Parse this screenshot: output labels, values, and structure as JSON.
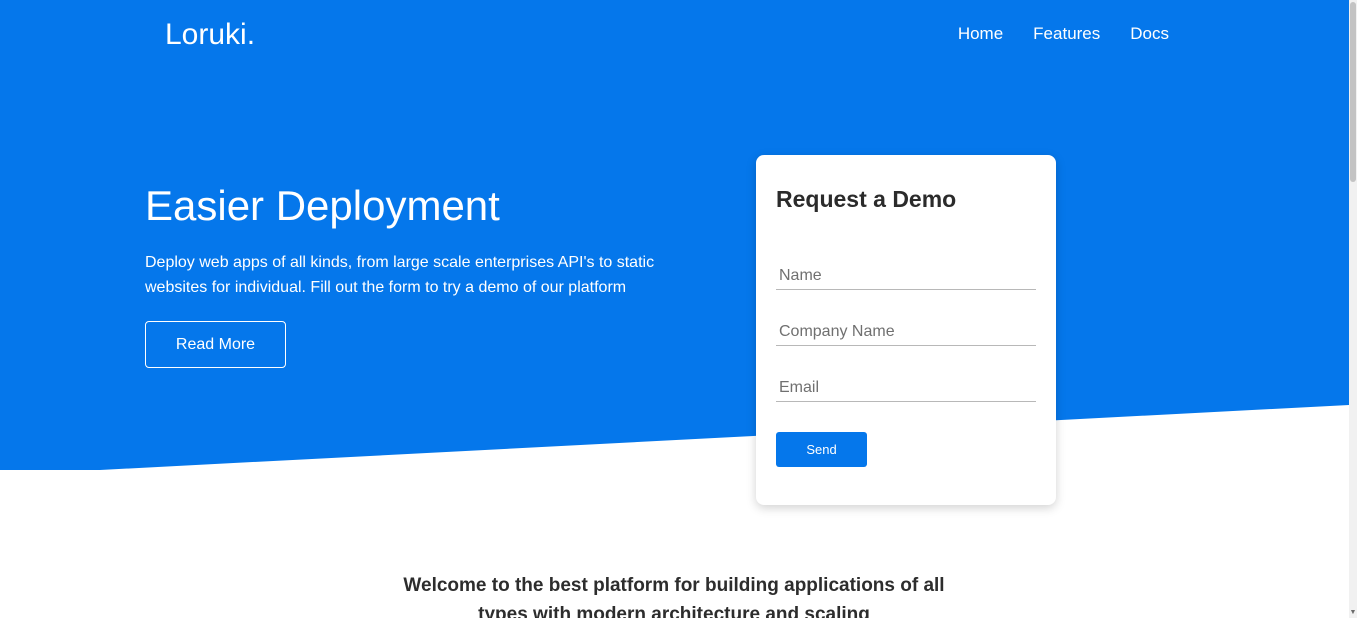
{
  "brand": {
    "name": "Loruki."
  },
  "nav": {
    "items": [
      {
        "label": "Home"
      },
      {
        "label": "Features"
      },
      {
        "label": "Docs"
      }
    ]
  },
  "hero": {
    "title": "Easier Deployment",
    "text": "Deploy web apps of all kinds, from large scale enterprises API's to static websites for individual. Fill out the form to try a demo of our platform",
    "read_more_label": "Read More"
  },
  "demo_form": {
    "title": "Request a Demo",
    "name_placeholder": "Name",
    "company_placeholder": "Company Name",
    "email_placeholder": "Email",
    "send_label": "Send"
  },
  "welcome": {
    "text": "Welcome to the best platform for building applications of all types with modern architecture and scaling"
  },
  "colors": {
    "primary": "#0577eb",
    "card_bg": "#ffffff",
    "text_dark": "#2d2d2d"
  },
  "icons": {
    "scroll_down": "triangle-down"
  }
}
